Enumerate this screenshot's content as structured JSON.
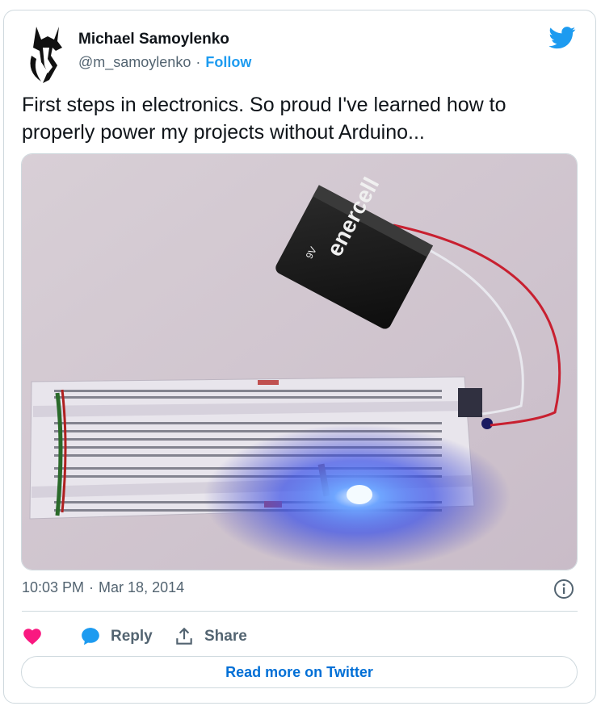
{
  "tweet": {
    "author_name": "Michael Samoylenko",
    "handle": "@m_samoylenko",
    "separator": "·",
    "follow_label": "Follow",
    "text": "First steps in electronics. So proud I've learned how to properly power my projects without Arduino...",
    "time": "10:03 PM",
    "date": "Mar 18, 2014",
    "photo_battery_brand": "enercell",
    "photo_battery_voltage": "9V"
  },
  "actions": {
    "reply_label": "Reply",
    "share_label": "Share"
  },
  "footer": {
    "read_more_label": "Read more on Twitter"
  },
  "icons": {
    "brand": "twitter-bird-icon",
    "like": "heart-icon",
    "reply": "speech-bubble-icon",
    "share": "share-upload-icon",
    "info": "info-icon"
  },
  "colors": {
    "twitter_blue": "#1d9bf0",
    "link_blue": "#006fd6",
    "heart": "#f91880",
    "muted": "#536471",
    "border": "#cfd9de"
  }
}
